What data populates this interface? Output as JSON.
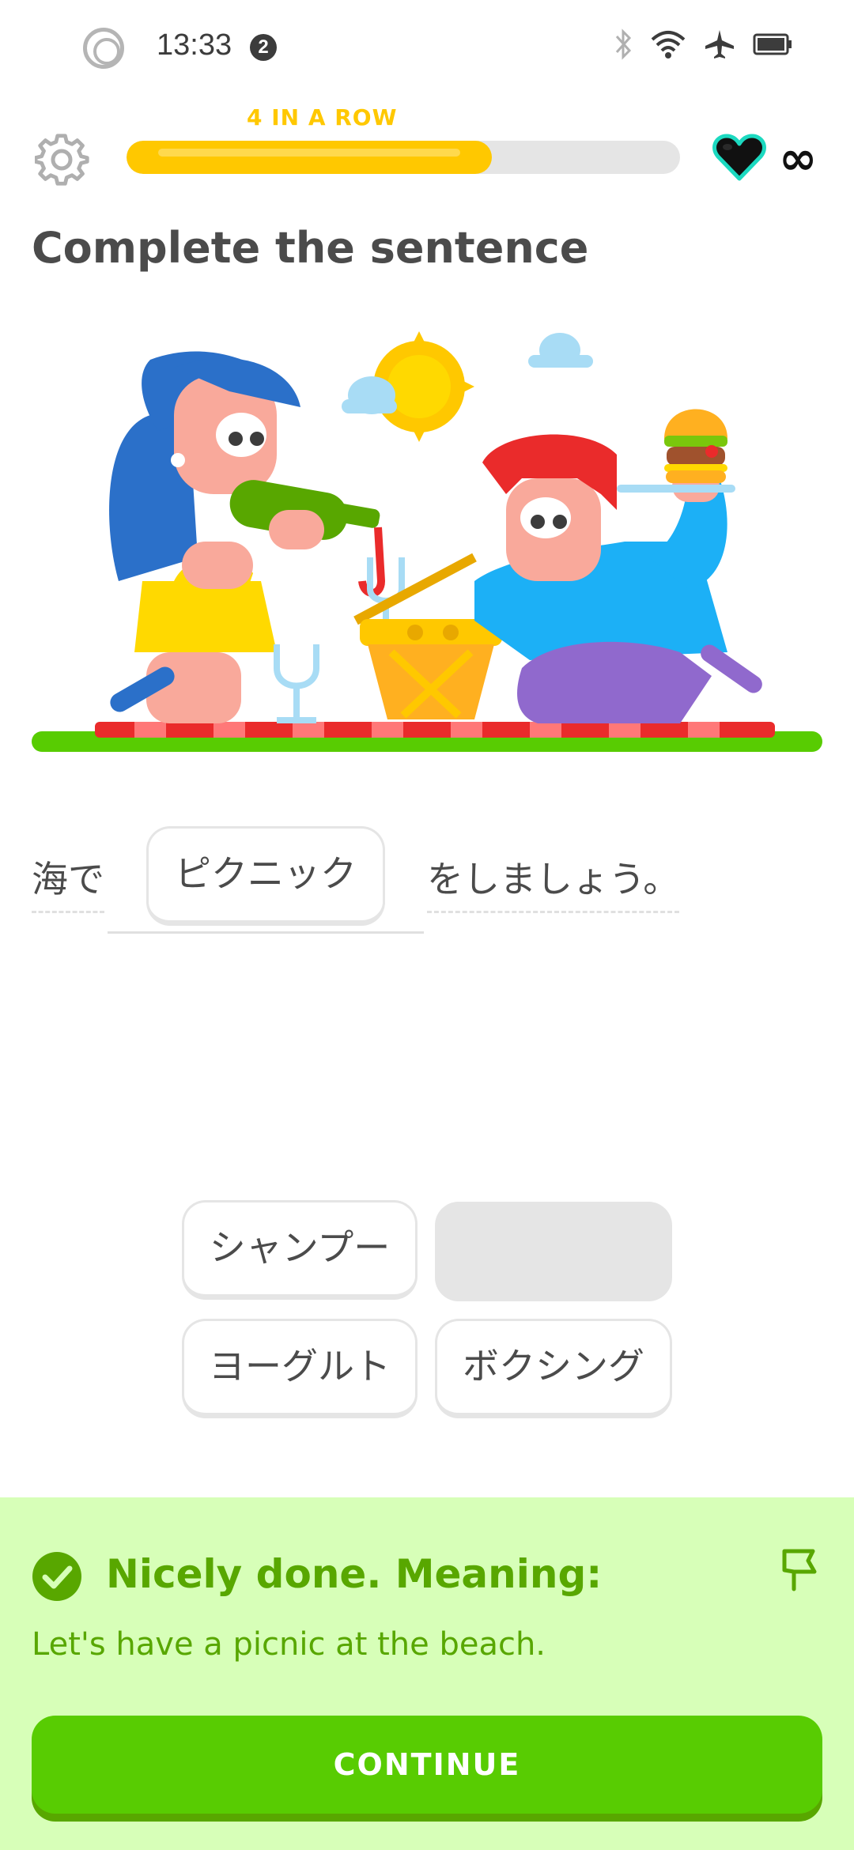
{
  "status_bar": {
    "time": "13:33",
    "notification_count": "2"
  },
  "header": {
    "streak_label": "4 IN A ROW",
    "progress": 0.66,
    "lives": "∞"
  },
  "instruction": "Complete the sentence",
  "sentence": {
    "before": "海で",
    "answer": "ピクニック",
    "after": "をしましょう。"
  },
  "word_bank": [
    {
      "label": "シャンプー"
    },
    {
      "label": ""
    },
    {
      "label": "ヨーグルト"
    },
    {
      "label": "ボクシング"
    }
  ],
  "feedback": {
    "title": "Nicely done. Meaning:",
    "meaning": "Let's have a picnic at the beach.",
    "continue_label": "CONTINUE"
  },
  "colors": {
    "accent_green": "#58cc02",
    "success_text": "#58a700",
    "success_bg": "#d7ffb8",
    "streak_yellow": "#ffc800"
  }
}
